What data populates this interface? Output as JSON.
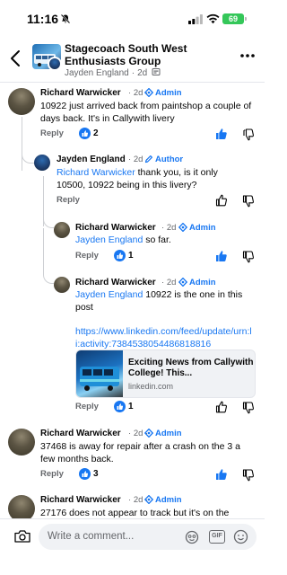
{
  "status_bar": {
    "time": "11:16",
    "battery": "69"
  },
  "header": {
    "group_title": "Stagecoach South West Enthusiasts Group",
    "author": "Jayden England",
    "age": "2d"
  },
  "comments": [
    {
      "name": "Richard Warwicker",
      "age": "2d",
      "badge": "Admin",
      "text": "10922 just arrived back from paintshop a couple of days back. It's in Callywith livery",
      "reply_label": "Reply",
      "reaction_count": "2"
    },
    {
      "name": "Jayden England",
      "age": "2d",
      "badge": "Author",
      "mention": "Richard Warwicker",
      "text": " thank you, is it only 10500, 10922 being in this livery?",
      "reply_label": "Reply"
    },
    {
      "name": "Richard Warwicker",
      "age": "2d",
      "badge": "Admin",
      "mention": "Jayden England",
      "text": " so far.",
      "reply_label": "Reply",
      "reaction_count": "1"
    },
    {
      "name": "Richard Warwicker",
      "age": "2d",
      "badge": "Admin",
      "mention": "Jayden England",
      "text": " 10922 is the one in this post",
      "url": "https://www.linkedin.com/feed/update/urn:li:activity:7384538054486818816",
      "link_title": "Exciting News from Callywith College! This...",
      "link_domain": "linkedin.com",
      "reply_label": "Reply",
      "reaction_count": "1"
    },
    {
      "name": "Richard Warwicker",
      "age": "2d",
      "badge": "Admin",
      "text": "37468 is away for repair after a crash on the 3 a few months back.",
      "reply_label": "Reply",
      "reaction_count": "3"
    },
    {
      "name": "Richard Warwicker",
      "age": "2d",
      "badge": "Admin",
      "text": "27176 does not appear to track but it's on the"
    }
  ],
  "composer": {
    "placeholder": "Write a comment...",
    "gif_label": "GIF"
  },
  "colors": {
    "accent": "#1877f2",
    "secondary_text": "#65676b",
    "thread_line": "#ced0d4"
  }
}
